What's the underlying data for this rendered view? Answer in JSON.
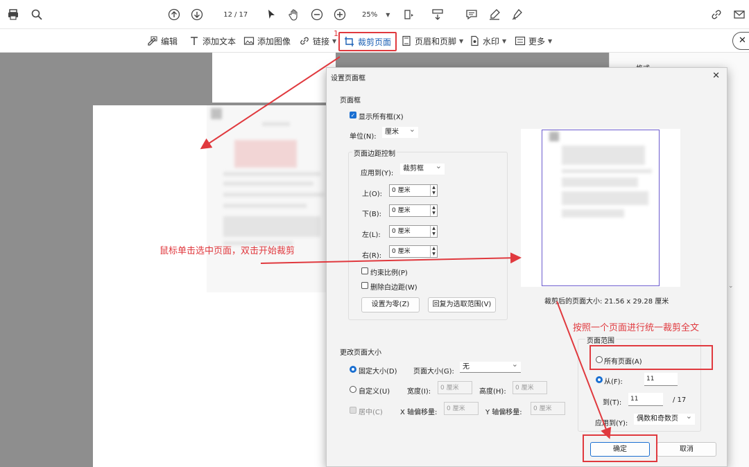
{
  "toolbar": {
    "page_current": "12",
    "page_total": "/ 17",
    "zoom": "25%"
  },
  "edit_toolbar": {
    "edit": "编辑",
    "add_text": "添加文本",
    "add_image": "添加图像",
    "link": "链接",
    "crop": "裁剪页面",
    "header_footer": "页眉和页脚",
    "watermark": "水印",
    "more": "更多",
    "step_number": "1"
  },
  "dialog": {
    "title": "设置页面框",
    "close": "✕",
    "page_boxes": {
      "legend": "页面框",
      "show_all": "显示所有框(X)",
      "unit_label": "单位(N):",
      "unit_value": "厘米"
    },
    "margins": {
      "legend": "页面边距控制",
      "apply_label": "应用到(Y):",
      "apply_value": "裁剪框",
      "top_label": "上(O):",
      "bottom_label": "下(B):",
      "left_label": "左(L):",
      "right_label": "右(R):",
      "top_value": "0 厘米",
      "bottom_value": "0 厘米",
      "left_value": "0 厘米",
      "right_value": "0 厘米",
      "constrain": "约束比例(P)",
      "remove_white": "删除白边距(W)",
      "set_zero": "设置为零(Z)",
      "revert": "回复为选取范围(V)"
    },
    "preview_caption": "裁剪后的页面大小: 21.56 x 29.28 厘米",
    "resize": {
      "legend": "更改页面大小",
      "fixed": "固定大小(D)",
      "page_size_label": "页面大小(G):",
      "page_size_value": "无",
      "custom": "自定义(U)",
      "width_label": "宽度(I):",
      "width_value": "0 厘米",
      "height_label": "高度(H):",
      "height_value": "0 厘米",
      "center": "居中(C)",
      "x_offset_label": "X 轴偏移量:",
      "x_offset_value": "0 厘米",
      "y_offset_label": "Y 轴偏移量:",
      "y_offset_value": "0 厘米"
    },
    "range": {
      "legend": "页面范围",
      "all_pages": "所有页面(A)",
      "from_label": "从(F):",
      "from_value": "11",
      "to_label": "到(T):",
      "to_value": "11",
      "of_total": "/ 17",
      "apply_label": "应用到(Y):",
      "apply_value": "偶数和奇数页"
    },
    "ok": "确定",
    "cancel": "取消"
  },
  "annotations": {
    "click_hint": "鼠标单击选中页面，双击开始裁剪",
    "uniform_hint": "按照一个页面进行统一裁剪全文"
  },
  "right_pane": {
    "format_label": "格式"
  },
  "colors": {
    "accent": "#1a6fd1",
    "highlight": "#e0393e",
    "canvas": "#8e8e8e"
  }
}
